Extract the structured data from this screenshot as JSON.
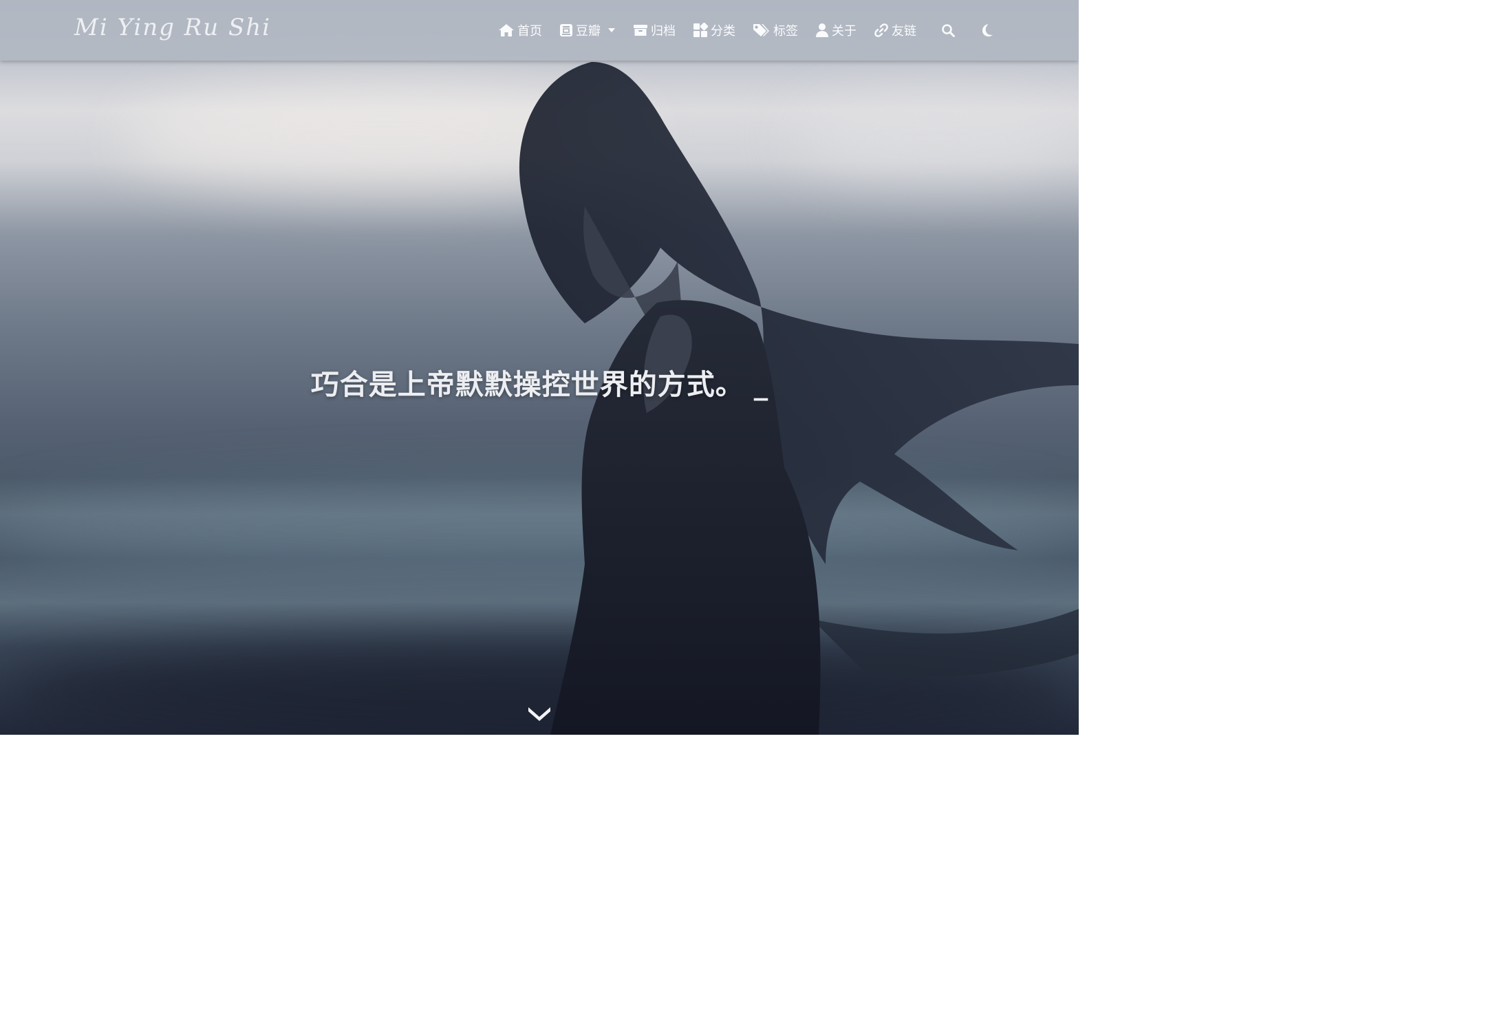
{
  "site": {
    "logo_text": "Mi Ying Ru Shi"
  },
  "nav": {
    "items": [
      {
        "label": "首页",
        "icon": "home-icon"
      },
      {
        "label": "豆瓣",
        "icon": "douban-icon",
        "has_dropdown": true
      },
      {
        "label": "归档",
        "icon": "archive-icon"
      },
      {
        "label": "分类",
        "icon": "category-icon"
      },
      {
        "label": "标签",
        "icon": "tag-icon"
      },
      {
        "label": "关于",
        "icon": "user-icon"
      },
      {
        "label": "友链",
        "icon": "link-icon"
      }
    ],
    "search_icon": "search-icon",
    "theme_icon": "moon-icon"
  },
  "hero": {
    "subtitle": "巧合是上帝默默操控世界的方式。",
    "cursor": "_",
    "scroll_icon": "chevron-down-icon"
  },
  "colors": {
    "header_bg": "#b0b7c1",
    "nav_text": "#fafbfc",
    "subtitle_text": "#eceef1"
  }
}
